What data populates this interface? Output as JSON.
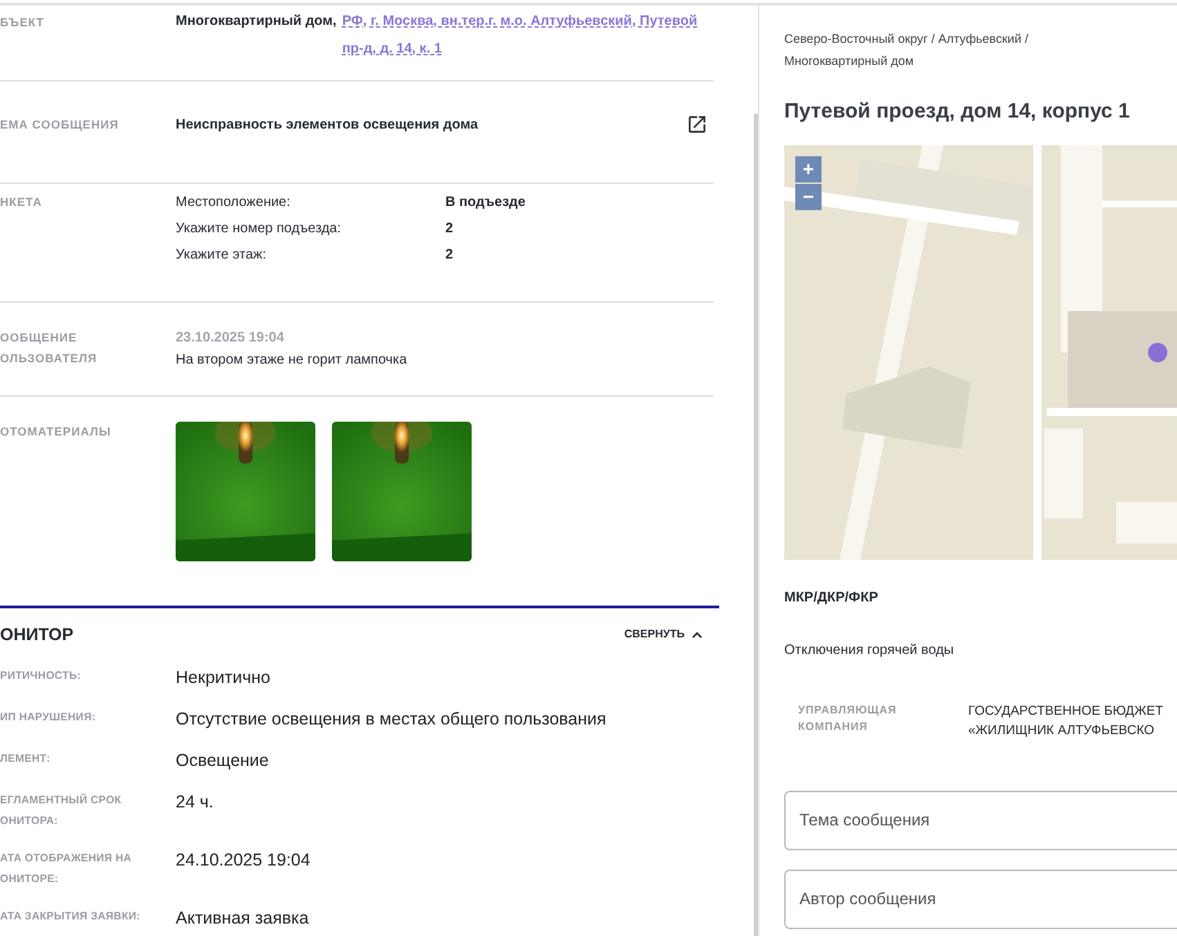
{
  "details": [
    {
      "kind": "object",
      "label": "БЪЕКТ",
      "title": "Многоквартирный дом,",
      "link": "РФ, г. Москва, вн.тер.г. м.о. Алтуфьевский, Путевой пр-д, д. 14, к. 1"
    },
    {
      "kind": "topic",
      "label": "ЕМА СООБЩЕНИЯ",
      "text": "Неисправность элементов освещения дома"
    },
    {
      "kind": "form",
      "label": "НКЕТА",
      "answers": [
        {
          "question": "Местоположение:",
          "answer": "В подъезде"
        },
        {
          "question": "Укажите номер подъезда:",
          "answer": "2"
        },
        {
          "question": "Укажите этаж:",
          "answer": "2"
        }
      ]
    },
    {
      "kind": "message",
      "label": "ООБЩЕНИЕ ОЛЬЗОВАТЕЛЯ",
      "date": "23.10.2025 19:04",
      "text": "На втором этаже не горит лампочка"
    },
    {
      "kind": "photos",
      "label": "ОТОМАТЕРИАЛЫ"
    }
  ],
  "monitor": {
    "title": "ОНИТОР",
    "collapse": "СВЕРНУТЬ",
    "expanded": true,
    "rows": [
      {
        "label": "РИТИЧНОСТЬ:",
        "value": "Некритично"
      },
      {
        "label": "ИП НАРУШЕНИЯ:",
        "value": "Отсутствие освещения в местах общего пользования"
      },
      {
        "label": "ЛЕМЕНТ:",
        "value": "Освещение"
      },
      {
        "label": "ЕГЛАМЕНТНЫЙ СРОК ОНИТОРА:",
        "value": "24 ч."
      },
      {
        "label": "АТА ОТОБРАЖЕНИЯ НА ОНИТОРЕ:",
        "value": "24.10.2025 19:04"
      },
      {
        "label": "АТА ЗАКРЫТИЯ ЗАЯВКИ:",
        "value": "Активная заявка"
      }
    ]
  },
  "side": {
    "breadcrumb": "Северо-Восточный округ / Алтуфьевский / Многоквартирный дом",
    "title": "Путевой проезд, дом 14, корпус 1",
    "map": {
      "zoom_in": "+",
      "zoom_out": "−"
    },
    "program": "МКР/ДКР/ФКР",
    "outage": "Отключения горячей воды",
    "company": {
      "label": "УПРАВЛЯЮЩАЯ КОМПАНИЯ",
      "lines": [
        "ГОСУДАРСТВЕННОЕ БЮДЖЕТ",
        "«ЖИЛИЩНИК АЛТУФЬЕВСКО"
      ]
    },
    "fields": [
      {
        "placeholder": "Тема сообщения"
      },
      {
        "placeholder": "Автор сообщения"
      }
    ]
  }
}
